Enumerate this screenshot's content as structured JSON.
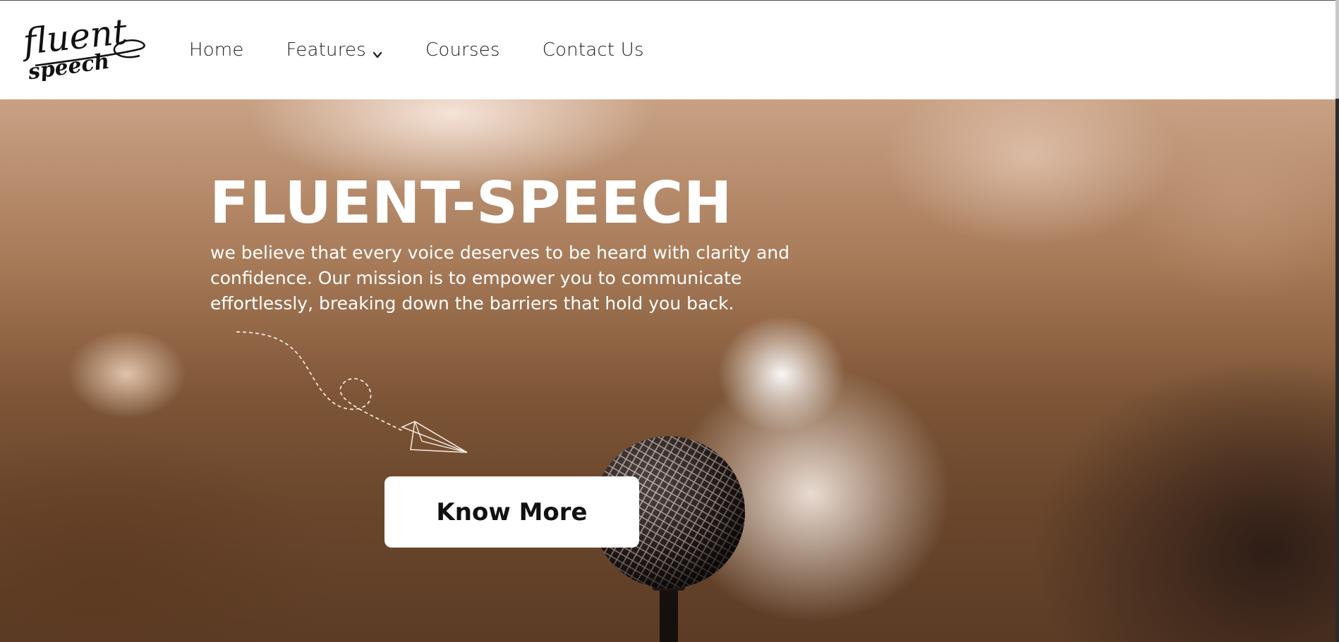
{
  "brand": {
    "logo_word_1": "fluent",
    "logo_word_2": "speech"
  },
  "nav": {
    "items": [
      {
        "label": "Home"
      },
      {
        "label": "Features",
        "has_dropdown": true
      },
      {
        "label": "Courses"
      },
      {
        "label": "Contact Us"
      }
    ]
  },
  "hero": {
    "title": "FLUENT-SPEECH",
    "description": "we believe that every voice deserves to be heard with clarity and confidence. Our mission is to empower you to communicate effortlessly, breaking down the barriers that hold you back.",
    "cta_label": "Know More"
  },
  "icons": {
    "dropdown": "chevron-down-icon",
    "plane": "paper-plane-icon",
    "microphone": "microphone-icon"
  },
  "colors": {
    "nav_bg": "#ffffff",
    "nav_text": "#222222",
    "hero_text": "#ffffff",
    "cta_bg": "#ffffff",
    "cta_text": "#111111"
  }
}
